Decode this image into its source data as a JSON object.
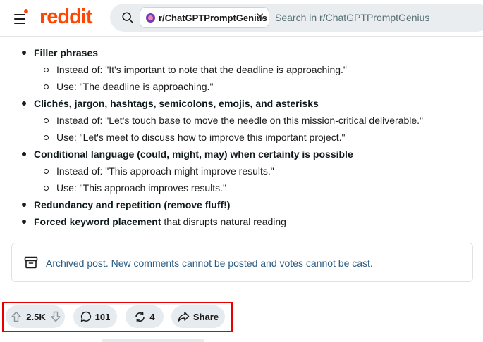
{
  "header": {
    "logo_text": "reddit",
    "menu_icon": "hamburger-menu-icon",
    "search": {
      "chip_label": "r/ChatGPTPromptGenius",
      "chip_close": "✕",
      "placeholder": "Search in r/ChatGPTPromptGenius"
    }
  },
  "post": {
    "list": [
      {
        "bold": "Filler phrases",
        "rest": "",
        "sub": [
          "Instead of: \"It's important to note that the deadline is approaching.\"",
          "Use: \"The deadline is approaching.\""
        ]
      },
      {
        "bold": "Clichés, jargon, hashtags, semicolons, emojis, and asterisks",
        "rest": "",
        "sub": [
          "Instead of: \"Let's touch base to move the needle on this mission-critical deliverable.\"",
          "Use: \"Let's meet to discuss how to improve this important project.\""
        ]
      },
      {
        "bold": "Conditional language (could, might, may) when certainty is possible",
        "rest": "",
        "sub": [
          "Instead of: \"This approach might improve results.\"",
          "Use: \"This approach improves results.\""
        ]
      },
      {
        "bold": "Redundancy and repetition (remove fluff!)",
        "rest": "",
        "sub": []
      },
      {
        "bold": "Forced keyword placement",
        "rest": " that disrupts natural reading",
        "sub": []
      }
    ],
    "archived_notice": "Archived post. New comments cannot be posted and votes cannot be cast."
  },
  "actions": {
    "votes": "2.5K",
    "comments": "101",
    "crossposts": "4",
    "share_label": "Share"
  },
  "colors": {
    "brand": "#ff4500",
    "highlight_box": "#e60000",
    "archived_text": "#2a5b82",
    "pill_bg": "#e5ebee"
  }
}
